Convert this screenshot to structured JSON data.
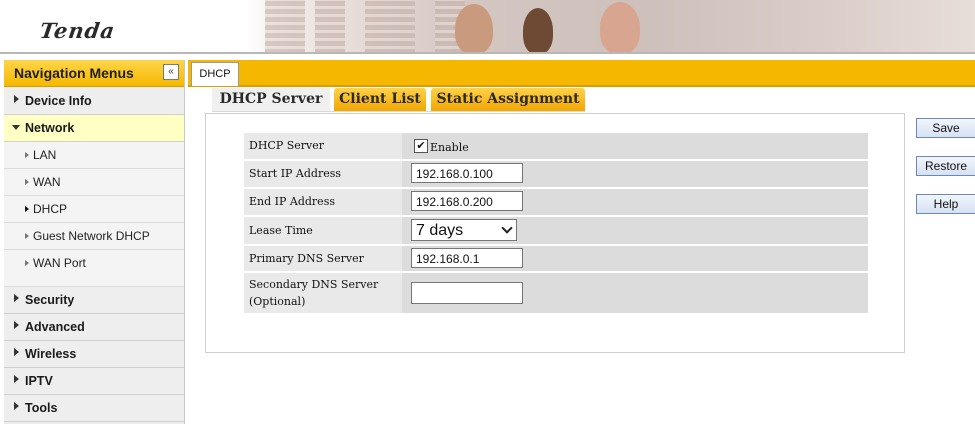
{
  "header": {
    "logo": "Tenda"
  },
  "sidebar": {
    "title": "Navigation Menus",
    "collapse_icon": "«",
    "items": [
      {
        "label": "Device Info"
      },
      {
        "label": "Network"
      },
      {
        "label": "Security"
      },
      {
        "label": "Advanced"
      },
      {
        "label": "Wireless"
      },
      {
        "label": "IPTV"
      },
      {
        "label": "Tools"
      }
    ],
    "network_sub": [
      {
        "label": "LAN"
      },
      {
        "label": "WAN"
      },
      {
        "label": "DHCP"
      },
      {
        "label": "Guest Network DHCP"
      },
      {
        "label": "WAN Port"
      }
    ]
  },
  "tabs": {
    "main": "DHCP",
    "sub": [
      "DHCP Server",
      "Client List",
      "Static Assignment"
    ]
  },
  "form": {
    "dhcp_server_label": "DHCP Server",
    "enable_label": "Enable",
    "enable_checked_glyph": "✔",
    "start_ip_label": "Start IP Address",
    "start_ip_value": "192.168.0.100",
    "end_ip_label": "End IP Address",
    "end_ip_value": "192.168.0.200",
    "lease_label": "Lease Time",
    "lease_value": "7 days",
    "primary_dns_label": "Primary DNS Server",
    "primary_dns_value": "192.168.0.1",
    "secondary_dns_label_1": "Secondary DNS Server",
    "secondary_dns_label_2": "(Optional)",
    "secondary_dns_value": ""
  },
  "buttons": {
    "save": "Save",
    "restore": "Restore",
    "help": "Help"
  },
  "colors": {
    "accent": "#f5b800",
    "active_nav": "#ffffc4",
    "button_border": "#6d87b8"
  }
}
